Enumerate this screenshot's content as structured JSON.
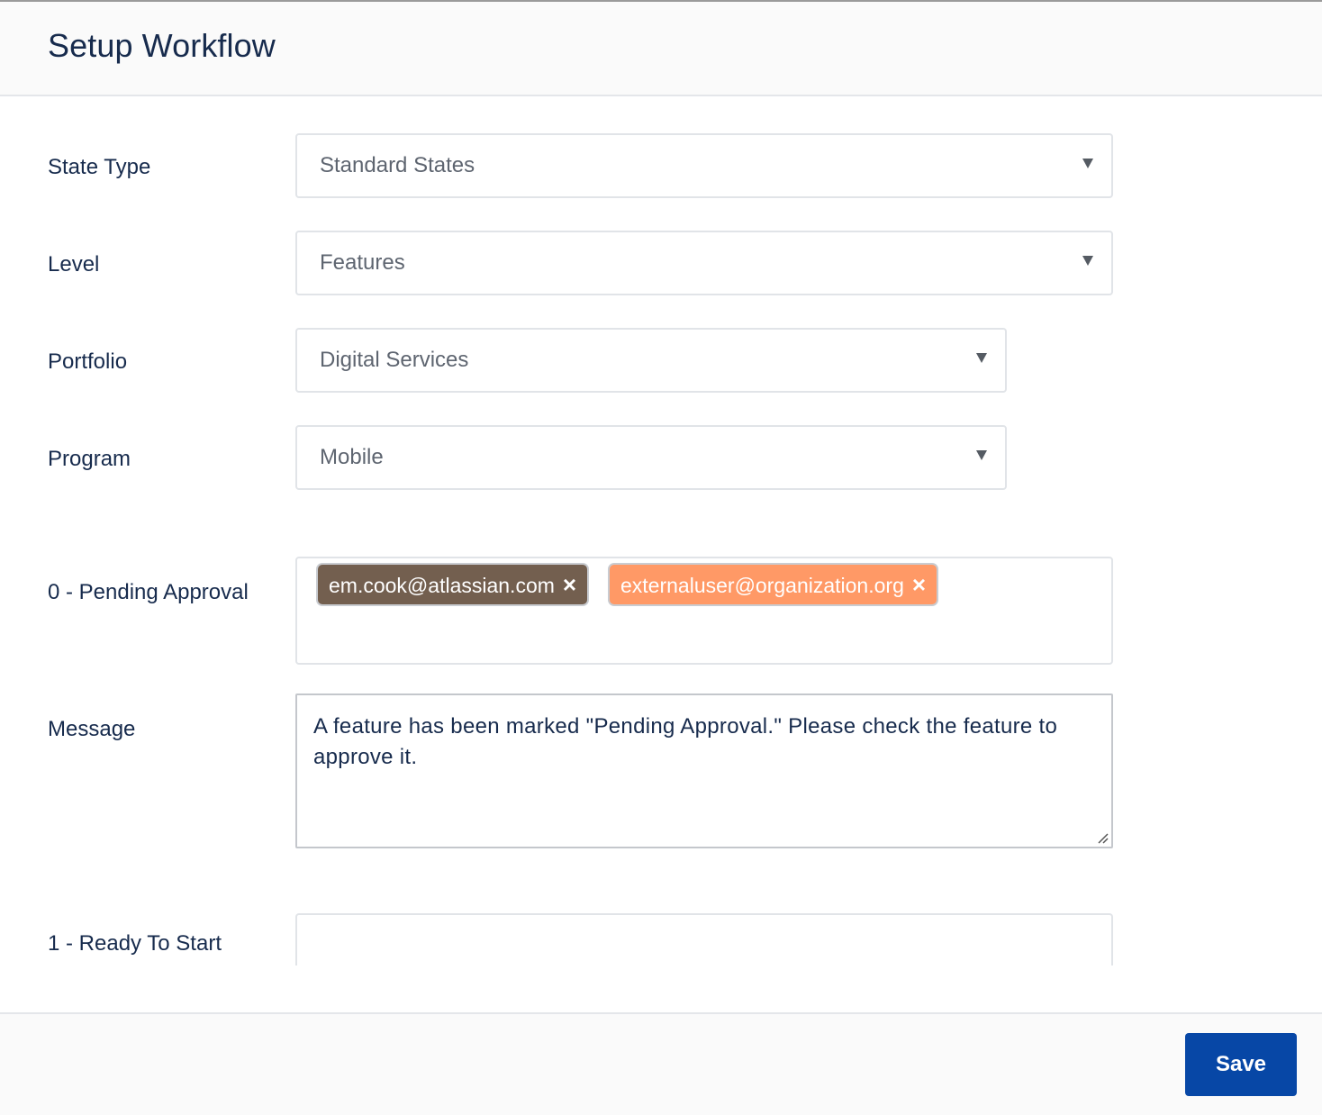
{
  "header": {
    "title": "Setup Workflow"
  },
  "form": {
    "state_type": {
      "label": "State Type",
      "value": "Standard States"
    },
    "level": {
      "label": "Level",
      "value": "Features"
    },
    "portfolio": {
      "label": "Portfolio",
      "value": "Digital Services"
    },
    "program": {
      "label": "Program",
      "value": "Mobile"
    },
    "pending_approval": {
      "label": "0 - Pending Approval",
      "tags": [
        {
          "text": "em.cook@atlassian.com",
          "remove": "×",
          "color": "#735f4f"
        },
        {
          "text": "externaluser@organization.org",
          "remove": "×",
          "color": "#ff9966"
        }
      ]
    },
    "message": {
      "label": "Message",
      "value": "A feature has been marked \"Pending Approval.\" Please check the feature to approve it."
    },
    "ready_to_start": {
      "label": "1 - Ready To Start"
    }
  },
  "footer": {
    "save_label": "Save"
  },
  "icons": {
    "caret": "chevron-down-icon",
    "tag_remove": "close-icon",
    "resize": "resize-grip-icon"
  },
  "colors": {
    "primary": "#0747a6",
    "text": "#172b4d"
  }
}
